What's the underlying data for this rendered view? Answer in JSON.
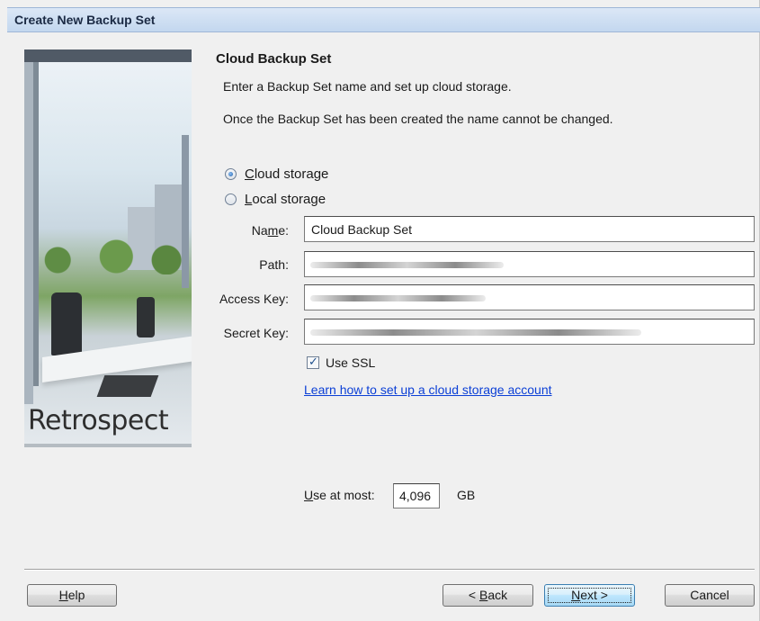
{
  "window": {
    "title": "Create New Backup Set"
  },
  "sidebar": {
    "brand": "Retrospect"
  },
  "page": {
    "section_title": "Cloud Backup Set",
    "instruction_1": "Enter a Backup Set name and set up cloud storage.",
    "instruction_2": "Once the Backup Set has been created the name cannot be changed."
  },
  "storage_options": {
    "cloud": {
      "label_prefix": "",
      "label_mnemonic": "C",
      "label_rest": "loud storage",
      "selected": true
    },
    "local": {
      "label_prefix": "",
      "label_mnemonic": "L",
      "label_rest": "ocal storage",
      "selected": false
    }
  },
  "fields": {
    "name": {
      "label_prefix": "Na",
      "label_mnemonic": "m",
      "label_rest": "e:",
      "value": "Cloud Backup Set"
    },
    "path": {
      "label": "Path:"
    },
    "access_key": {
      "label": "Access Key:"
    },
    "secret_key": {
      "label": "Secret Key:"
    }
  },
  "use_ssl": {
    "label": "Use SSL",
    "checked": true
  },
  "help_link": "Learn how to set up a cloud storage account",
  "use_at_most": {
    "label_mnemonic": "U",
    "label_rest": "se at most:",
    "value": "4,096",
    "unit": "GB"
  },
  "buttons": {
    "help": {
      "mnemonic": "H",
      "rest": "elp"
    },
    "back": {
      "prefix": "< ",
      "mnemonic": "B",
      "rest": "ack"
    },
    "next": {
      "mnemonic": "N",
      "rest": "ext >"
    },
    "cancel": "Cancel"
  }
}
